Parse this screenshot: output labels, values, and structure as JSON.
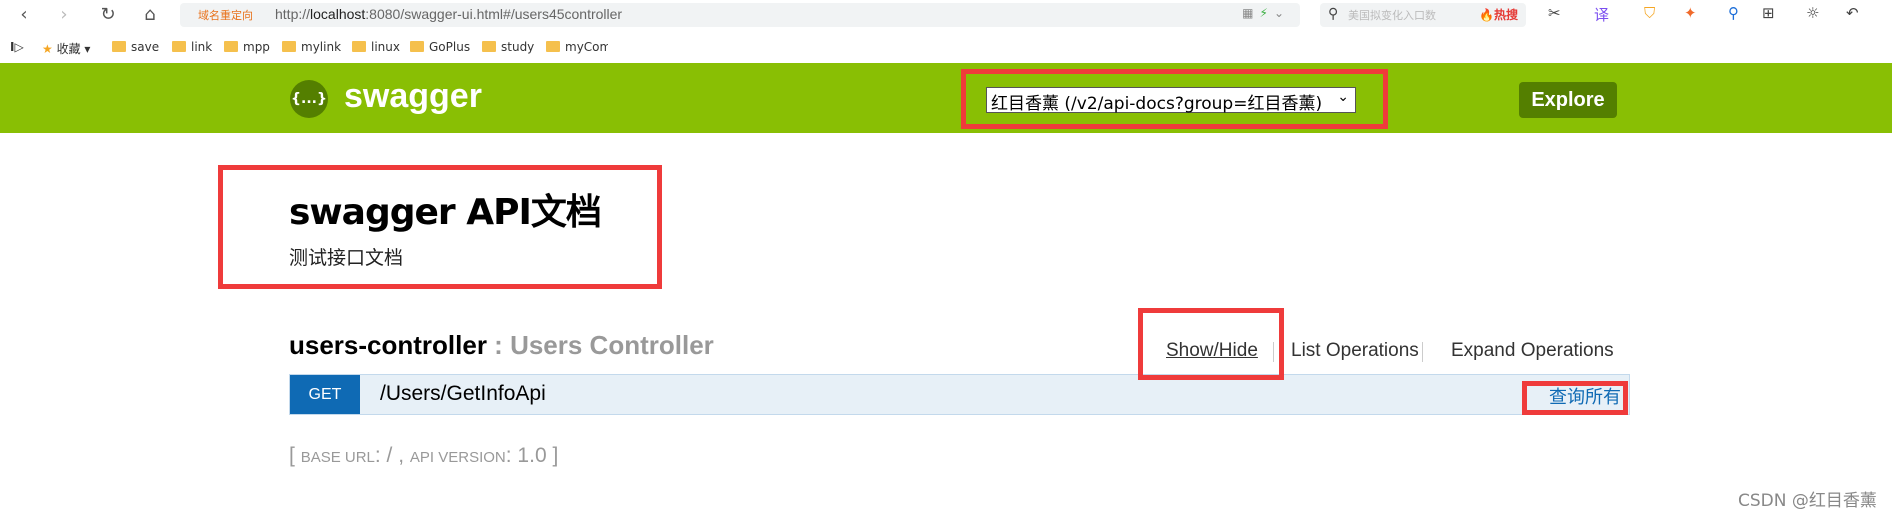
{
  "browser": {
    "address_tag": "域名重定向",
    "url_host": "localhost",
    "url_prefix": "http://",
    "url_rest": ":8080/swagger-ui.html#/users45controller",
    "search_placeholder": "美国拟变化入口数",
    "search_hot": "🔥热搜"
  },
  "bookmarks": [
    {
      "label": "收藏",
      "icon": "star-icon"
    },
    {
      "label": "save",
      "icon": "folder-icon"
    },
    {
      "label": "link",
      "icon": "folder-icon"
    },
    {
      "label": "mpp",
      "icon": "folder-icon"
    },
    {
      "label": "mylink",
      "icon": "folder-icon"
    },
    {
      "label": "linux",
      "icon": "folder-icon"
    },
    {
      "label": "GoPlus",
      "icon": "folder-icon"
    },
    {
      "label": "study",
      "icon": "folder-icon"
    },
    {
      "label": "myCom",
      "icon": "folder-icon"
    }
  ],
  "header": {
    "logo_glyph": "{...}",
    "title": "swagger",
    "group_select_value": "红目香薰 (/v2/api-docs?group=红目香薰)",
    "explore_label": "Explore",
    "brand_color": "#89bf04"
  },
  "info": {
    "title": "swagger API文档",
    "description": "测试接口文档"
  },
  "resource": {
    "name": "users-controller",
    "separator": " : ",
    "description": "Users Controller",
    "show_hide": "Show/Hide",
    "list_operations": "List Operations",
    "expand_operations": "Expand Operations"
  },
  "operation": {
    "method": "GET",
    "path": "/Users/GetInfoApi",
    "summary": "查询所有",
    "method_color": "#0f6ab4"
  },
  "footer": {
    "open_bracket": "[",
    "base_url_label": "BASE URL",
    "base_url_value": ": / , ",
    "api_version_label": "API VERSION",
    "api_version_value": ": 1.0",
    "close_bracket": "]"
  },
  "watermark": "CSDN @红目香薰",
  "annotation_color": "#ef3b3b"
}
